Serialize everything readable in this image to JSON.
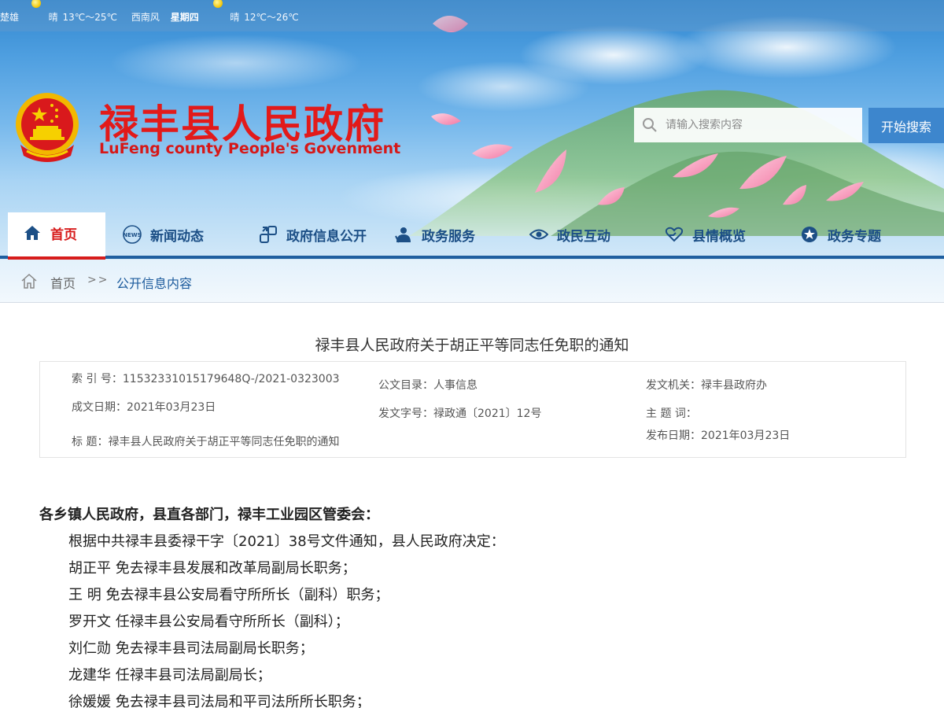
{
  "weather": {
    "city": "楚雄",
    "today_condition": "晴",
    "today_temp": "13℃～25℃",
    "wind": "西南风",
    "weekday": "星期四",
    "next_condition": "晴",
    "next_temp": "12℃～26℃"
  },
  "site": {
    "title": "禄丰县人民政府",
    "subtitle": "LuFeng county People's Govenment"
  },
  "search": {
    "placeholder": "请输入搜索内容",
    "button_label": "开始搜索"
  },
  "nav": {
    "items": [
      {
        "label": "首页",
        "icon": "home-icon"
      },
      {
        "label": "新闻动态",
        "icon": "news-icon"
      },
      {
        "label": "政府信息公开",
        "icon": "share-icon"
      },
      {
        "label": "政务服务",
        "icon": "service-icon"
      },
      {
        "label": "政民互动",
        "icon": "eye-icon"
      },
      {
        "label": "县情概览",
        "icon": "heart-hand-icon"
      },
      {
        "label": "政务专题",
        "icon": "star-icon"
      }
    ],
    "active_index": 0
  },
  "breadcrumb": {
    "home": "首页",
    "separator": ">>",
    "current": "公开信息内容"
  },
  "article": {
    "title": "禄丰县人民政府关于胡正平等同志任免职的通知",
    "meta": {
      "index_no": "索  引  号：11532331015179648Q-/2021-0323003",
      "catalog": "公文目录：人事信息",
      "issuer": "发文机关：禄丰县政府办",
      "created_date": "成文日期：2021年03月23日",
      "doc_no": "发文字号：禄政通〔2021〕12号",
      "keywords": "主  题  词：",
      "published_date": "发布日期：2021年03月23日",
      "subject": "标      题：禄丰县人民政府关于胡正平等同志任免职的通知"
    },
    "greeting": "各乡镇人民政府，县直各部门，禄丰工业园区管委会：",
    "paragraphs": [
      "根据中共禄丰县委禄干字〔2021〕38号文件通知，县人民政府决定：",
      "胡正平 免去禄丰县发展和改革局副局长职务；",
      "王  明 免去禄丰县公安局看守所所长（副科）职务；",
      "罗开文 任禄丰县公安局看守所所长（副科）；",
      "刘仁勋 免去禄丰县司法局副局长职务；",
      "龙建华 任禄丰县司法局副局长；",
      "徐媛媛 免去禄丰县司法局和平司法所所长职务；"
    ]
  },
  "colors": {
    "brand_red": "#e21a1a",
    "nav_blue": "#1c4f86",
    "search_button": "#3d86cd"
  }
}
